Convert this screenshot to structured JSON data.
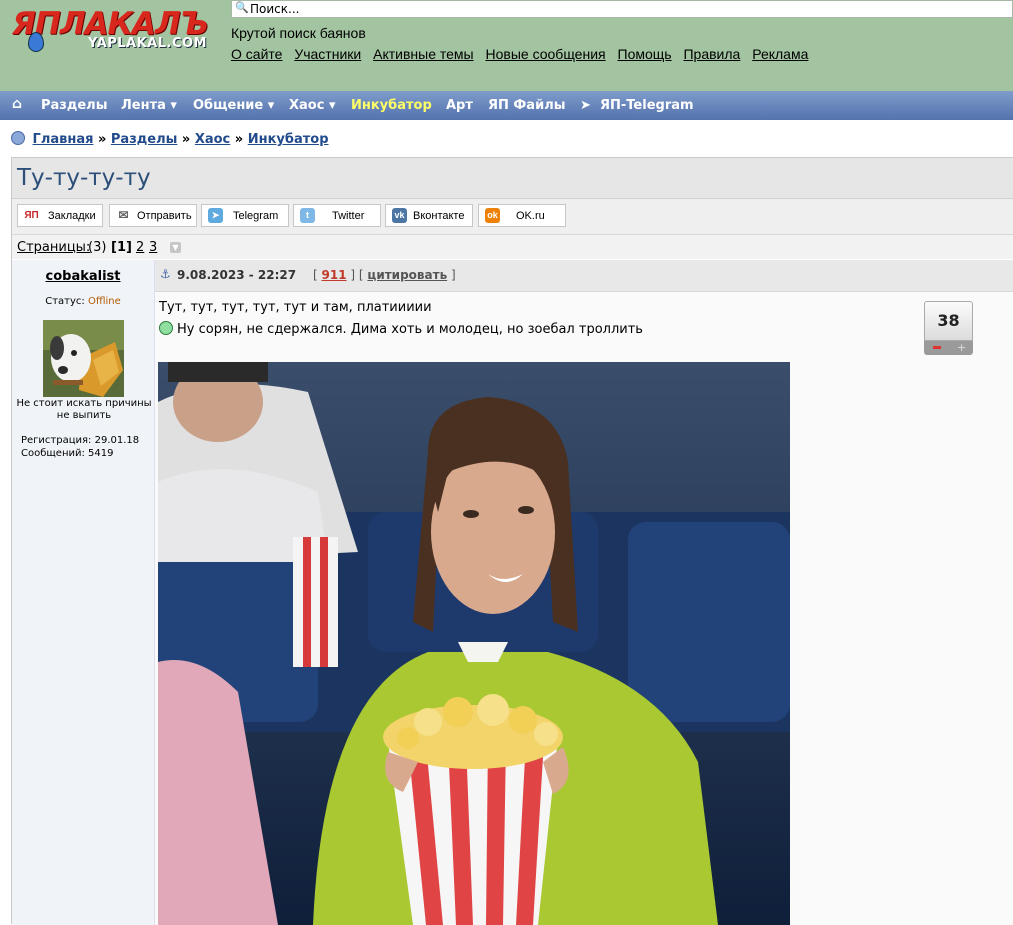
{
  "header": {
    "logo_main": "ЯПЛАКАЛЪ",
    "logo_sub": "YAPLAKAL.COM",
    "search_placeholder": "Поиск...",
    "slogan": "Крутой поиск баянов",
    "links": [
      "О сайте",
      "Участники",
      "Активные темы",
      "Новые сообщения",
      "Помощь",
      "Правила",
      "Реклама"
    ]
  },
  "nav": {
    "items": [
      "Разделы",
      "Лента ▾",
      "Общение ▾",
      "Хаос ▾",
      "Инкубатор",
      "Арт",
      "ЯП Файлы",
      "ЯП-Telegram"
    ],
    "highlight_color": "#ffff66"
  },
  "breadcrumb": {
    "items": [
      "Главная",
      "Разделы",
      "Хаос",
      "Инкубатор"
    ],
    "separator": "»"
  },
  "topic": {
    "title": "Ту-ту-ту-ту",
    "share": [
      "Закладки",
      "Отправить",
      "Telegram",
      "Twitter",
      "Вконтакте",
      "OK.ru"
    ],
    "share_icon_labels": [
      "ЯП",
      "✉",
      "➤",
      "t",
      "vk",
      "ok"
    ],
    "pages_label": "Страницы:",
    "pages_count": "(3)",
    "current_page": "[1]",
    "pages": [
      "2",
      "3"
    ]
  },
  "author": {
    "name": "cobakalist",
    "status_label": "Статус:",
    "status_value": "Offline",
    "signature": "Не стоит искать причины не выпить",
    "registration": "Регистрация: 29.01.18",
    "posts": "Сообщений: 5419"
  },
  "post": {
    "date": "9.08.2023 - 22:27",
    "rating_open": "[",
    "rating": "911",
    "rating_close": "] [",
    "quote": "цитировать",
    "quote_close": "]",
    "line1": "Тут, тут, тут, тут, тут и там, платиииии",
    "line2": "Ну сорян, не сдержался. Дима хоть и молодец, но зоебал троллить",
    "votes": "38"
  }
}
